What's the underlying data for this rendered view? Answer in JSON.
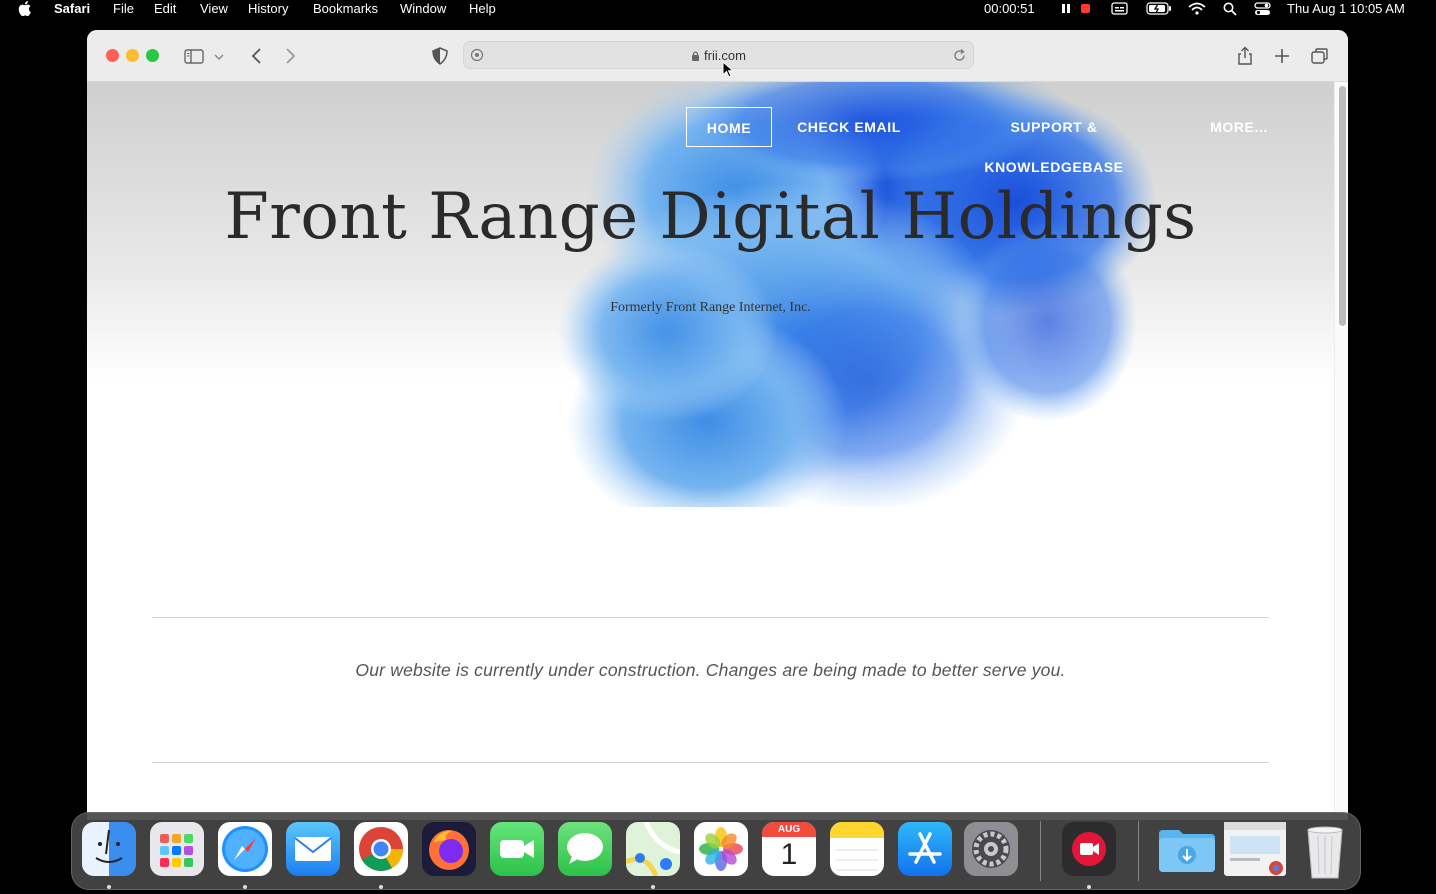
{
  "menubar": {
    "app_name": "Safari",
    "menus": [
      "File",
      "Edit",
      "View",
      "History",
      "Bookmarks",
      "Window",
      "Help"
    ],
    "recording_time": "00:00:51",
    "clock": "Thu Aug 1  10:05 AM"
  },
  "browser": {
    "url": "frii.com"
  },
  "site": {
    "nav": [
      "HOME",
      "CHECK EMAIL",
      "SUPPORT & KNOWLEDGEBASE",
      "MORE..."
    ],
    "active_nav": "HOME",
    "title": "Front Range Digital Holdings",
    "subtitle": "Formerly Front Range Internet, Inc.",
    "notice": "Our website is currently under construction. Changes are being made to better serve you."
  },
  "dock": {
    "apps": [
      "finder-icon",
      "launchpad-icon",
      "safari-icon",
      "mail-icon",
      "chrome-icon",
      "firefox-icon",
      "facetime-icon",
      "messages-icon",
      "maps-icon",
      "photos-icon",
      "calendar-icon",
      "notes-icon",
      "app-store-icon",
      "system-settings-icon",
      "screen-recorder-icon",
      "downloads-folder-icon",
      "chrome-window-thumbnail",
      "trash-icon"
    ],
    "calendar_month": "AUG",
    "calendar_day": "1"
  },
  "colors": {
    "traffic_red": "#ff5f57",
    "traffic_yellow": "#febc2e",
    "traffic_green": "#28c840",
    "recording_red": "#ff3b30"
  }
}
